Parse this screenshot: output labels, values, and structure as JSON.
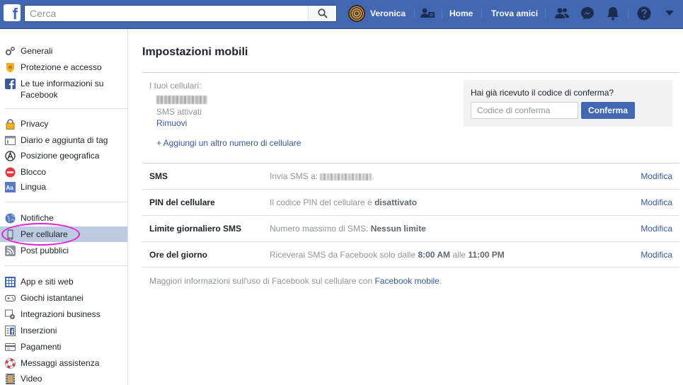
{
  "topbar": {
    "logo": "f",
    "search_placeholder": "Cerca",
    "user_name": "Veronica",
    "home": "Home",
    "find_friends": "Trova amici",
    "icons": [
      "search-icon",
      "friend-requests-icon",
      "messenger-icon",
      "notifications-icon",
      "help-icon",
      "chevron-down-icon"
    ]
  },
  "sidebar": {
    "groups": [
      [
        {
          "label": "Generali",
          "icon": "gear-icon"
        },
        {
          "label": "Protezione e accesso",
          "icon": "shield-icon"
        },
        {
          "label": "Le tue informazioni su Facebook",
          "icon": "facebook-icon"
        }
      ],
      [
        {
          "label": "Privacy",
          "icon": "lock-icon"
        },
        {
          "label": "Diario e aggiunta di tag",
          "icon": "timeline-icon"
        },
        {
          "label": "Posizione geografica",
          "icon": "location-icon"
        },
        {
          "label": "Blocco",
          "icon": "block-icon"
        },
        {
          "label": "Lingua",
          "icon": "language-icon"
        }
      ],
      [
        {
          "label": "Notifiche",
          "icon": "globe-icon"
        },
        {
          "label": "Per cellulare",
          "icon": "mobile-icon",
          "active": true
        },
        {
          "label": "Post pubblici",
          "icon": "rss-icon"
        }
      ],
      [
        {
          "label": "App e siti web",
          "icon": "apps-icon"
        },
        {
          "label": "Giochi istantanei",
          "icon": "gamepad-icon"
        },
        {
          "label": "Integrazioni business",
          "icon": "business-icon"
        },
        {
          "label": "Inserzioni",
          "icon": "ads-icon"
        },
        {
          "label": "Pagamenti",
          "icon": "card-icon"
        },
        {
          "label": "Messaggi assistenza",
          "icon": "lifebuoy-icon"
        },
        {
          "label": "Video",
          "icon": "film-icon"
        }
      ]
    ]
  },
  "main": {
    "title": "Impostazioni mobili",
    "phones_label": "I tuoi cellulari:",
    "sms_status": "SMS attivati",
    "remove": "Rimuovi",
    "add_phone": "+ Aggiungi un altro numero di cellulare",
    "confirm": {
      "question": "Hai già ricevuto il codice di conferma?",
      "placeholder": "Codice di conferma",
      "button": "Conferma"
    },
    "settings": [
      {
        "name": "SMS",
        "desc_prefix": "Invia SMS a:",
        "desc_suffix": ".",
        "edit": "Modifica"
      },
      {
        "name": "PIN del cellulare",
        "desc_prefix": "Il codice PIN del cellulare è",
        "desc_bold": "disattivato",
        "edit": "Modifica"
      },
      {
        "name": "Limite giornaliero SMS",
        "desc_prefix": "Numero massimo di SMS:",
        "desc_bold": "Nessun limite",
        "edit": "Modifica"
      },
      {
        "name": "Ore del giorno",
        "desc_prefix": "Riceverai SMS da Facebook solo dalle",
        "desc_bold": "8:00 AM",
        "desc_mid": "alle",
        "desc_bold2": "11:00 PM",
        "edit": "Modifica"
      }
    ],
    "footer_text": "Maggiori informazioni sull'uso di Facebook sul cellulare con",
    "footer_link": "Facebook mobile",
    "footer_end": "."
  }
}
